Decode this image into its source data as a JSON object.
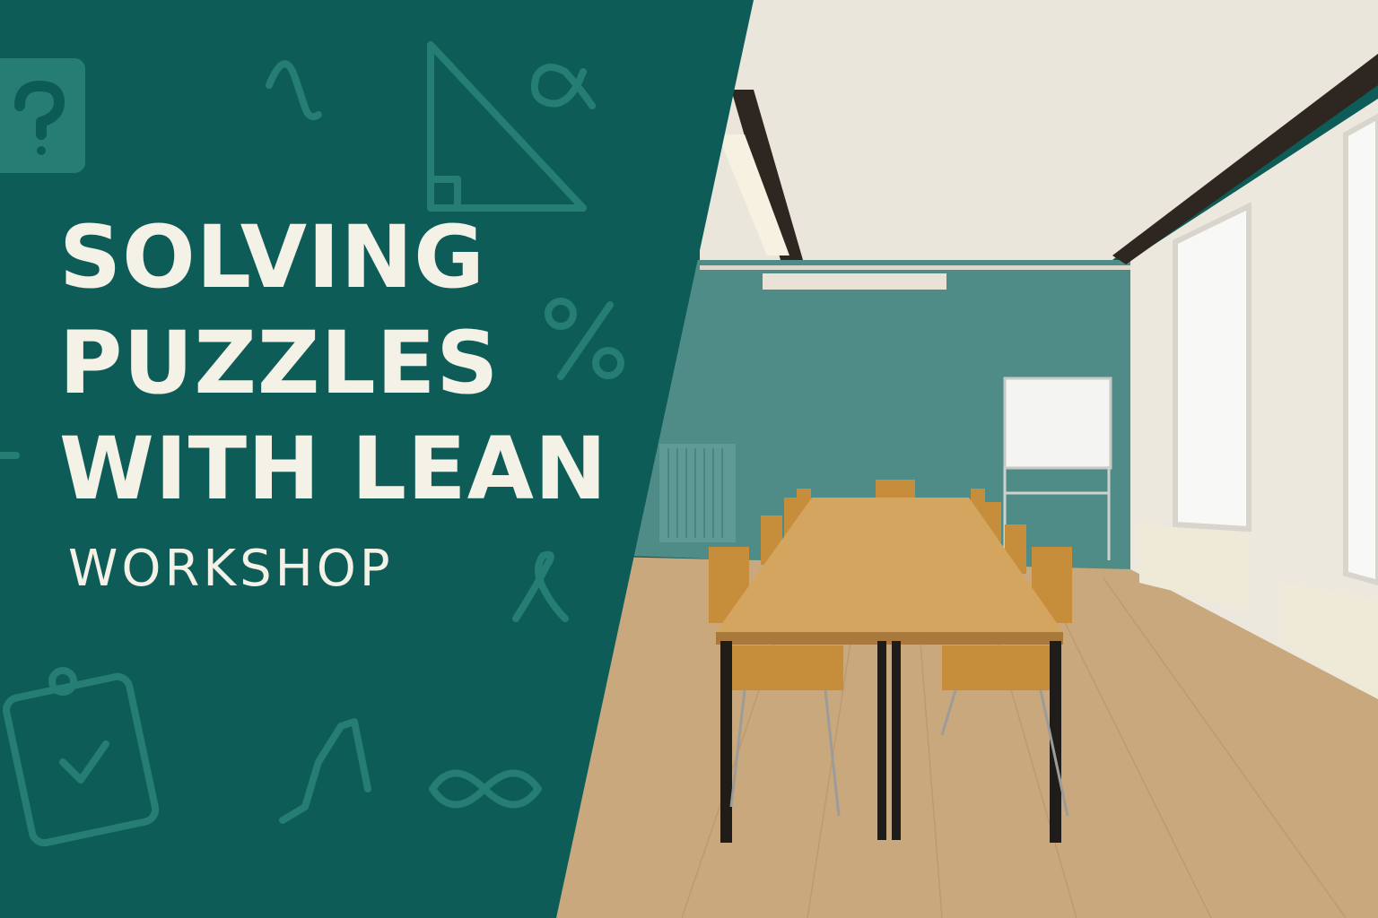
{
  "banner": {
    "title_lines": [
      "SOLVING",
      "PUZZLES",
      "WITH LEAN"
    ],
    "subtitle": "WORKSHOP"
  },
  "colors": {
    "panel": "#0d5c58",
    "text": "#f4f1e6",
    "wall": "#4f8c87",
    "floor": "#c8a57a",
    "table": "#d3a55e"
  },
  "decor_icons": [
    "question-block-icon",
    "lambda-icon",
    "triangle-icon",
    "alpha-icon",
    "percent-icon",
    "lambda-loop-icon",
    "clipboard-check-icon",
    "sqrt-icon",
    "infinity-icon"
  ]
}
